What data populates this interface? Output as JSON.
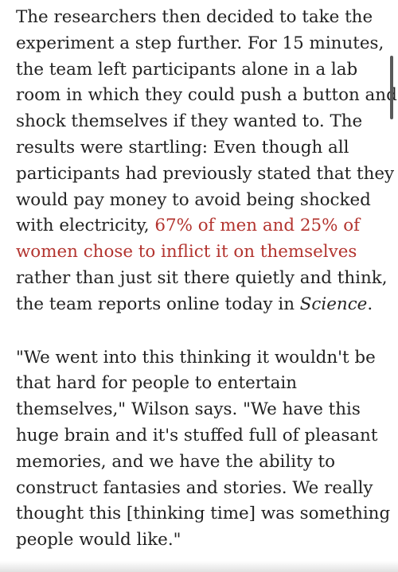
{
  "article": {
    "paragraph1": {
      "line1": "The researchers then decided to take the",
      "line2": "experiment a step further. For 15 minutes,",
      "line3": "the team left participants alone in a lab",
      "line4": "room in which they could push a button and",
      "line5": "shock themselves if they wanted to. The",
      "line6": "results were startling: Even though all",
      "line7": "participants had previously stated that they",
      "line8": "would pay money to avoid being shocked",
      "line9_pre": "with electricity, ",
      "line9_link": "67% of men and 25% of",
      "line10_link": "women chose to inflict it on themselves",
      "line11": "rather than just sit there quietly and think,",
      "line12_pre": "the team reports online today in ",
      "line12_ital": "Science",
      "line12_post": "."
    },
    "paragraph2": {
      "line1": "\"We went into this thinking it wouldn't be",
      "line2": "that hard for people to entertain",
      "line3": "themselves,\" Wilson says. \"We have this",
      "line4": "huge brain and it's stuffed full of pleasant",
      "line5": "memories, and we have the ability to",
      "line6": "construct fantasies and stories. We really",
      "line7": "thought this [thinking time] was something",
      "line8": "people would like.\""
    }
  },
  "colors": {
    "text": "#222222",
    "link": "#b3342f",
    "background": "#ffffff"
  }
}
